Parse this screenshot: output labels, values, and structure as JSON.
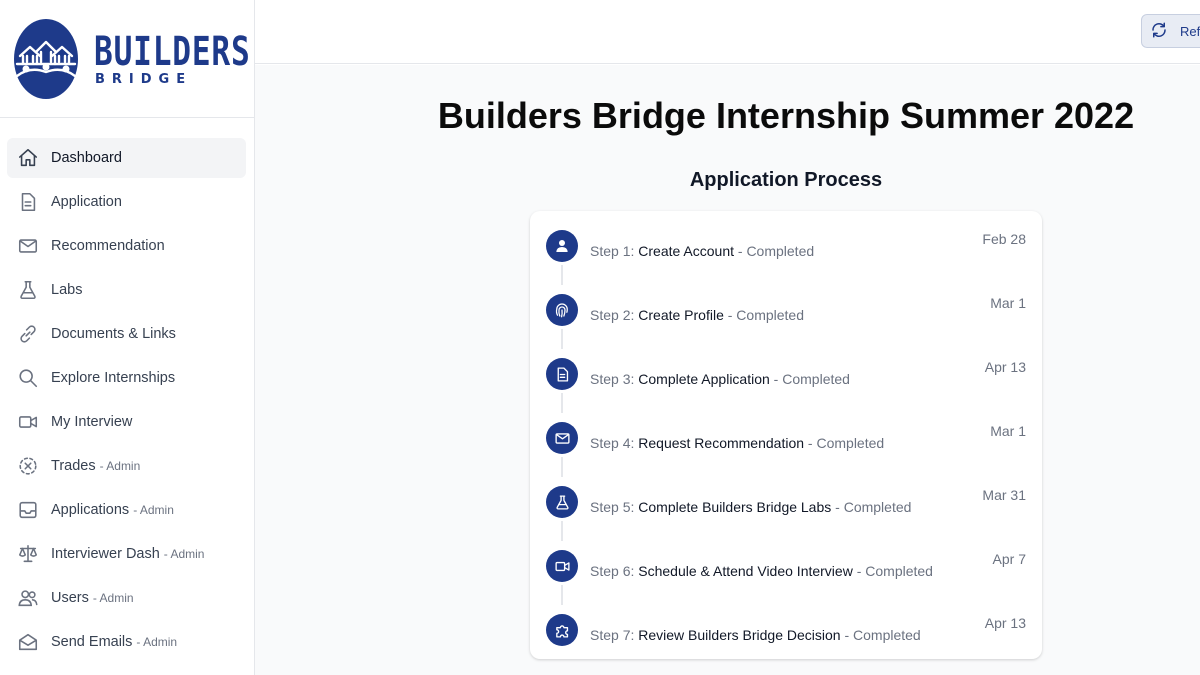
{
  "brand": {
    "name": "BUILDERS",
    "sub": "BRIDGE",
    "color": "#1e3a8a"
  },
  "sidebar": {
    "items": [
      {
        "label": "Dashboard",
        "suffix": "",
        "icon": "home-icon",
        "active": true
      },
      {
        "label": "Application",
        "suffix": "",
        "icon": "document-icon"
      },
      {
        "label": "Recommendation",
        "suffix": "",
        "icon": "mail-icon"
      },
      {
        "label": "Labs",
        "suffix": "",
        "icon": "beaker-icon"
      },
      {
        "label": "Documents & Links",
        "suffix": "",
        "icon": "link-icon"
      },
      {
        "label": "Explore Internships",
        "suffix": "",
        "icon": "search-icon"
      },
      {
        "label": "My Interview",
        "suffix": "",
        "icon": "video-icon"
      },
      {
        "label": "Trades",
        "suffix": "- Admin",
        "icon": "variable-icon"
      },
      {
        "label": "Applications",
        "suffix": "- Admin",
        "icon": "inbox-icon"
      },
      {
        "label": "Interviewer Dash",
        "suffix": "- Admin",
        "icon": "scale-icon"
      },
      {
        "label": "Users",
        "suffix": "- Admin",
        "icon": "users-icon"
      },
      {
        "label": "Send Emails",
        "suffix": "- Admin",
        "icon": "mail-open-icon"
      }
    ]
  },
  "topbar": {
    "refresh_label": "Refresh"
  },
  "main": {
    "title": "Builders Bridge Internship Summer 2022",
    "section_title": "Application Process",
    "steps": [
      {
        "prefix": "Step 1: ",
        "name": "Create Account",
        "status": " - Completed",
        "date": "Feb 28",
        "icon": "user-icon"
      },
      {
        "prefix": "Step 2: ",
        "name": "Create Profile",
        "status": " - Completed",
        "date": "Mar 1",
        "icon": "fingerprint-icon"
      },
      {
        "prefix": "Step 3: ",
        "name": "Complete Application",
        "status": " - Completed",
        "date": "Apr 13",
        "icon": "document-icon"
      },
      {
        "prefix": "Step 4: ",
        "name": "Request Recommendation",
        "status": " - Completed",
        "date": "Mar 1",
        "icon": "mail-icon"
      },
      {
        "prefix": "Step 5: ",
        "name": "Complete Builders Bridge Labs",
        "status": " - Completed",
        "date": "Mar 31",
        "icon": "beaker-icon"
      },
      {
        "prefix": "Step 6: ",
        "name": "Schedule & Attend Video Interview",
        "status": " - Completed",
        "date": "Apr 7",
        "icon": "video-icon"
      },
      {
        "prefix": "Step 7: ",
        "name": "Review Builders Bridge Decision",
        "status": " - Completed",
        "date": "Apr 13",
        "icon": "puzzle-icon"
      }
    ]
  }
}
